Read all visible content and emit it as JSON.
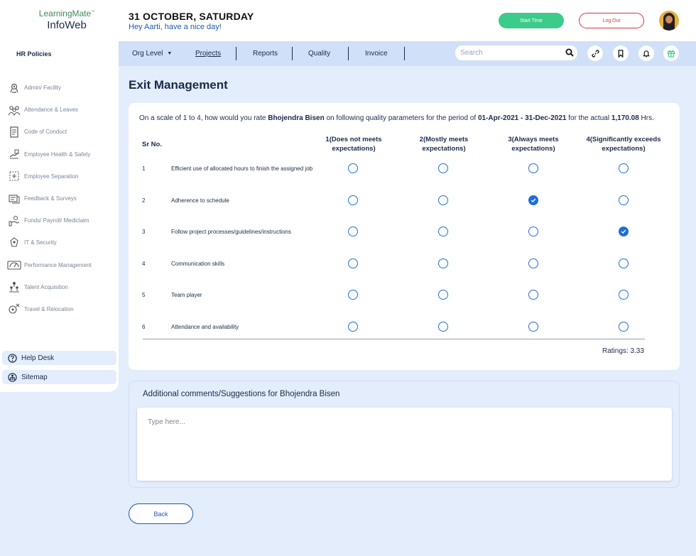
{
  "header": {
    "logo_top": "LearningMate",
    "logo_tm": "™",
    "logo_bottom": "InfoWeb",
    "date": "31 OCTOBER, SATURDAY",
    "greeting": "Hey Aarti, have a nice day!",
    "start_time_label": "Start Time",
    "logout_label": "Log Out"
  },
  "sidebar": {
    "title": "HR Policies",
    "items": [
      {
        "label": "Admin/ Facility",
        "icon": "building-icon"
      },
      {
        "label": "Attendance & Leaves",
        "icon": "team-icon"
      },
      {
        "label": "Code of Conduct",
        "icon": "document-icon"
      },
      {
        "label": "Employee Health & Safety",
        "icon": "health-icon"
      },
      {
        "label": "Employee Separation",
        "icon": "separation-icon"
      },
      {
        "label": "Feedback & Surveys",
        "icon": "feedback-icon"
      },
      {
        "label": "Funds/ Payroll/ Mediclaim",
        "icon": "payroll-icon"
      },
      {
        "label": "IT & Security",
        "icon": "security-icon"
      },
      {
        "label": "Performance Management",
        "icon": "performance-icon"
      },
      {
        "label": "Talent Acquisition",
        "icon": "talent-icon"
      },
      {
        "label": "Travel & Relocation",
        "icon": "travel-icon"
      }
    ],
    "help_desk": "Help Desk",
    "sitemap": "Sitemap"
  },
  "topnav": {
    "tabs": [
      "Org Level",
      "Projects",
      "Reports",
      "Quality",
      "Invoice"
    ],
    "org_level_caret": "▼",
    "search_placeholder": "Search"
  },
  "main": {
    "title": "Exit Management",
    "question": {
      "prefix": "On a scale of 1 to 4, how would you rate",
      "name": "Bhojendra Bisen",
      "middle": "on following quality parameters for the period of",
      "period": "01-Apr-2021 - 31-Dec-2021",
      "suffix_pre": "for the actual",
      "hours": "1,170.08",
      "suffix": "Hrs."
    },
    "table": {
      "sr_header": "Sr No.",
      "columns": [
        "1(Does not meets expectations)",
        "2(Mostly meets expectations)",
        "3(Always meets expectations)",
        "4(Significantly exceeds expectations)"
      ],
      "rows": [
        {
          "sr": "1",
          "param": "Efficient use of allocated hours to finish the assigned job",
          "selected": 0
        },
        {
          "sr": "2",
          "param": "Adherence to schedule",
          "selected": 3
        },
        {
          "sr": "3",
          "param": "Follow project processes/guidelines/instructions",
          "selected": 4
        },
        {
          "sr": "4",
          "param": "Communication skills",
          "selected": 0
        },
        {
          "sr": "5",
          "param": "Team player",
          "selected": 0
        },
        {
          "sr": "6",
          "param": "Attendance and availability",
          "selected": 0
        }
      ]
    },
    "ratings": "Ratings: 3.33",
    "comments_title": "Additional comments/Suggestions for Bhojendra Bisen",
    "comments_placeholder": "Type here...",
    "back_label": "Back"
  },
  "colors": {
    "accent": "#1e6fd9",
    "start_button": "#3ccb8a",
    "logout_border": "#d8343b",
    "background": "#e3edfb"
  }
}
